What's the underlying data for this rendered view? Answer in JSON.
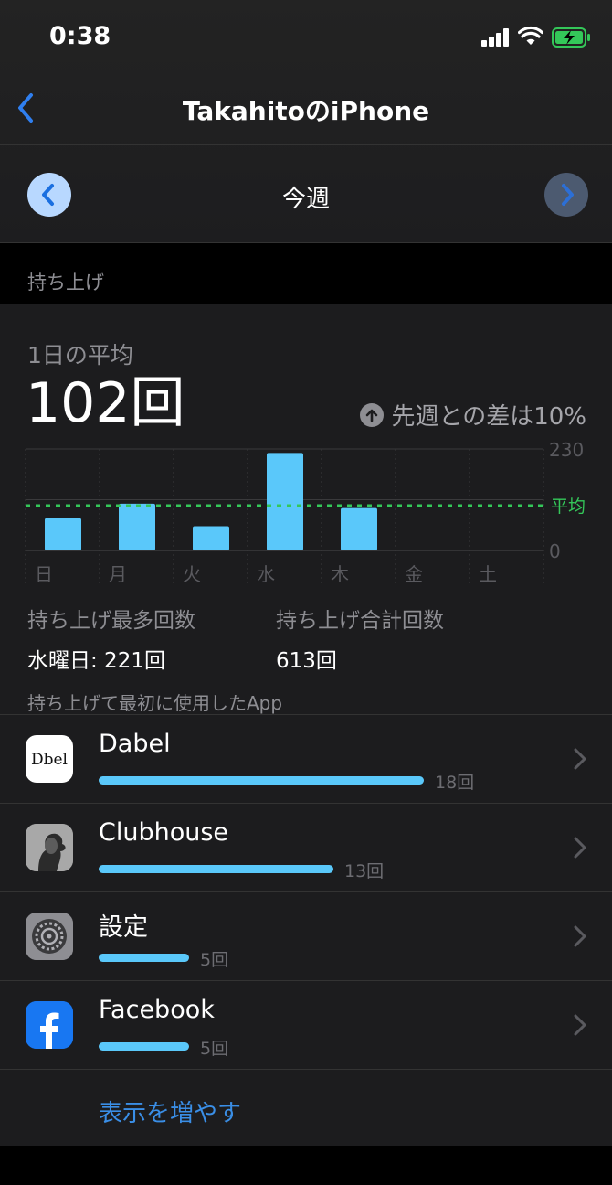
{
  "status_bar": {
    "time": "0:38"
  },
  "nav": {
    "title": "TakahitoのiPhone"
  },
  "week_nav": {
    "label": "今週"
  },
  "section": {
    "title": "持ち上げ"
  },
  "summary": {
    "avg_label": "1日の平均",
    "avg_value": "102回",
    "diff_text": "先週との差は10%"
  },
  "chart_data": {
    "type": "bar",
    "categories": [
      "日",
      "月",
      "火",
      "水",
      "木",
      "金",
      "土"
    ],
    "values": [
      73,
      106,
      55,
      221,
      96,
      null,
      null
    ],
    "ylim": [
      0,
      230
    ],
    "yticks": [
      "230",
      "0"
    ],
    "average": 102,
    "average_label": "平均",
    "grid": true,
    "colors": {
      "bar": "#5ac8fa",
      "average_line": "#34c759"
    }
  },
  "stats": {
    "max_label": "持ち上げ最多回数",
    "max_value": "水曜日: 221回",
    "total_label": "持ち上げ合計回数",
    "total_value": "613回"
  },
  "apps": {
    "header": "持ち上げて最初に使用したApp",
    "items": [
      {
        "name": "Dabel",
        "count": 18,
        "count_label": "18回",
        "icon": "dabel-icon"
      },
      {
        "name": "Clubhouse",
        "count": 13,
        "count_label": "13回",
        "icon": "clubhouse-icon"
      },
      {
        "name": "設定",
        "count": 5,
        "count_label": "5回",
        "icon": "settings-gear-icon"
      },
      {
        "name": "Facebook",
        "count": 5,
        "count_label": "5回",
        "icon": "facebook-icon"
      }
    ],
    "max_count": 18,
    "more_label": "表示を増やす",
    "icon_text": {
      "dabel": "Dbel"
    }
  },
  "colors": {
    "accent": "#3a8ee6",
    "bar": "#5ac8fa",
    "average": "#34c759",
    "battery": "#34c759"
  }
}
